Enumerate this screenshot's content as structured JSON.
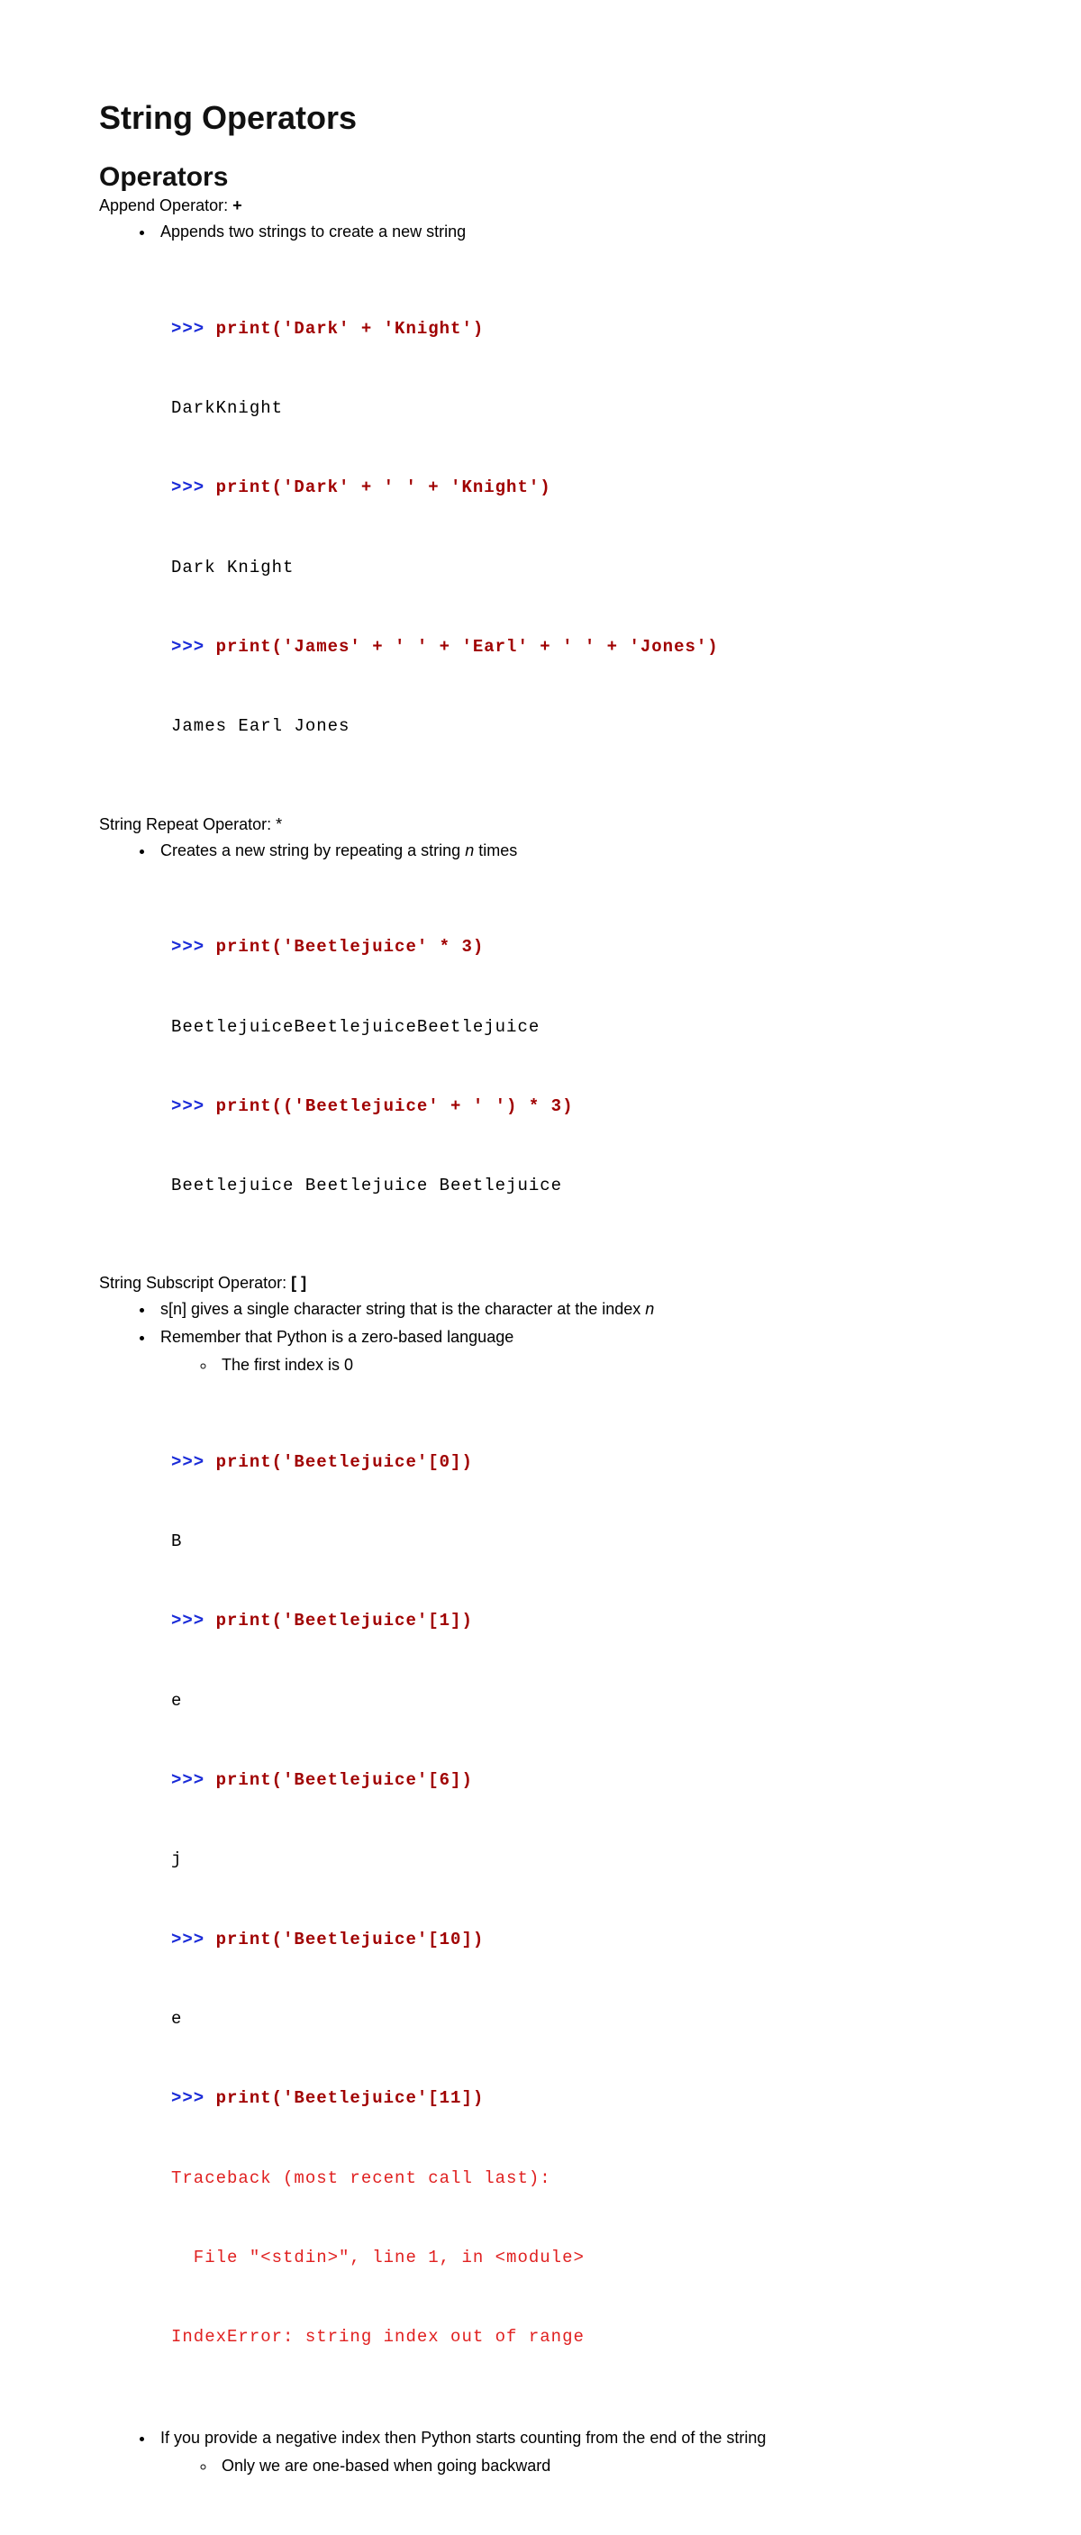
{
  "title": "String Operators",
  "section": "Operators",
  "append": {
    "label_prefix": "Append Operator: ",
    "symbol": "+",
    "bullet1": "Appends two strings to create a new string",
    "code": {
      "p1": ">>> ",
      "c1": "print('Dark' + 'Knight')",
      "o1": "DarkKnight",
      "p2": ">>> ",
      "c2": "print('Dark' + ' ' + 'Knight')",
      "o2": "Dark Knight",
      "p3": ">>> ",
      "c3": "print('James' + ' ' + 'Earl' + ' ' + 'Jones')",
      "o3": "James Earl Jones"
    }
  },
  "repeat": {
    "label_prefix": "String Repeat Operator: ",
    "symbol": "*",
    "bullet_prefix": "Creates a new string by repeating a string ",
    "bullet_n": "n",
    "bullet_suffix": " times",
    "code": {
      "p1": ">>> ",
      "c1": "print('Beetlejuice' * 3)",
      "o1": "BeetlejuiceBeetlejuiceBeetlejuice",
      "p2": ">>> ",
      "c2": "print(('Beetlejuice' + ' ') * 3)",
      "o2": "Beetlejuice Beetlejuice Beetlejuice "
    }
  },
  "subscript": {
    "label_prefix": "String Subscript Operator: ",
    "symbol": "[ ]",
    "bullet1_prefix": "s[n] gives a single character string that is the character at the index ",
    "bullet1_n": "n",
    "bullet2": "Remember that Python is a zero-based language",
    "sub1": "The first index is 0",
    "code": {
      "p1": ">>> ",
      "c1": "print('Beetlejuice'[0])",
      "o1": "B",
      "p2": ">>> ",
      "c2": "print('Beetlejuice'[1])",
      "o2": "e",
      "p3": ">>> ",
      "c3": "print('Beetlejuice'[6])",
      "o3": "j",
      "p4": ">>> ",
      "c4": "print('Beetlejuice'[10])",
      "o4": "e",
      "p5": ">>> ",
      "c5": "print('Beetlejuice'[11])",
      "e1": "Traceback (most recent call last):",
      "e2": "  File \"<stdin>\", line 1, in <module>",
      "e3": "IndexError: string index out of range"
    },
    "bullet3": "If you provide a negative index then Python starts counting from the end of the string",
    "sub2": "Only we are one-based when going backward"
  }
}
